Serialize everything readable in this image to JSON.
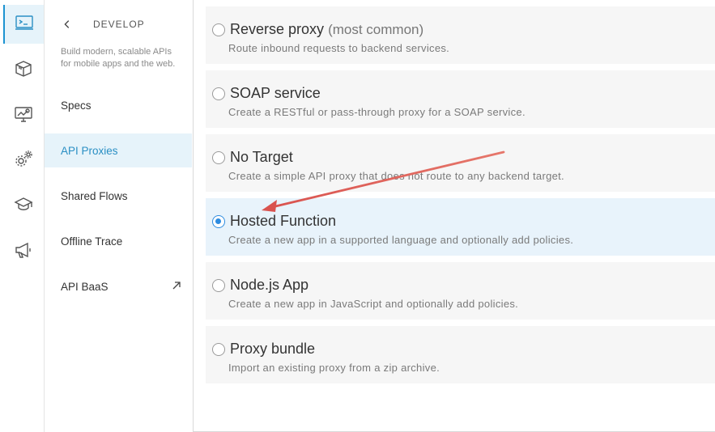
{
  "rail": {
    "items": [
      {
        "icon": "terminal-icon",
        "active": true
      },
      {
        "icon": "box-icon",
        "active": false
      },
      {
        "icon": "monitor-chart-icon",
        "active": false
      },
      {
        "icon": "gears-icon",
        "active": false
      },
      {
        "icon": "graduation-cap-icon",
        "active": false
      },
      {
        "icon": "megaphone-icon",
        "active": false
      }
    ]
  },
  "nav": {
    "back_icon": "chevron-left-icon",
    "title": "DEVELOP",
    "description": "Build modern, scalable APIs for mobile apps and the web.",
    "items": [
      {
        "label": "Specs",
        "active": false
      },
      {
        "label": "API Proxies",
        "active": true
      },
      {
        "label": "Shared Flows",
        "active": false
      },
      {
        "label": "Offline Trace",
        "active": false
      },
      {
        "label": "API BaaS",
        "active": false,
        "icon": "external-link-icon"
      }
    ]
  },
  "options": [
    {
      "title": "Reverse proxy",
      "note": "(most common)",
      "description": "Route inbound requests to backend services.",
      "selected": false
    },
    {
      "title": "SOAP service",
      "note": "",
      "description": "Create a RESTful or pass-through proxy for a SOAP service.",
      "selected": false
    },
    {
      "title": "No Target",
      "note": "",
      "description": "Create a simple API proxy that does not route to any backend target.",
      "selected": false
    },
    {
      "title": "Hosted Function",
      "note": "",
      "description": "Create a new app in a supported language and optionally add policies.",
      "selected": true
    },
    {
      "title": "Node.js App",
      "note": "",
      "description": "Create a new app in JavaScript and optionally add policies.",
      "selected": false
    },
    {
      "title": "Proxy bundle",
      "note": "",
      "description": "Import an existing proxy from a zip archive.",
      "selected": false
    }
  ],
  "colors": {
    "accent": "#1c93d1",
    "radio_selected": "#2d8ce0",
    "selected_bg": "#e8f3fb",
    "annotation_arrow": "#e0635a"
  }
}
